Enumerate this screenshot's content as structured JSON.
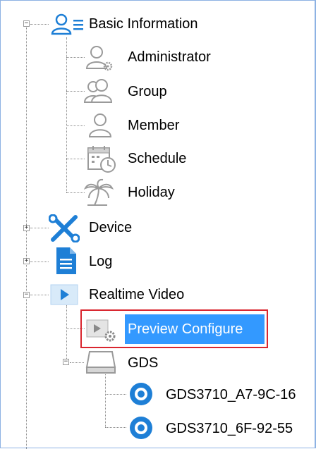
{
  "tree": {
    "basic_information": {
      "label": "Basic Information",
      "icon": "users-list-icon",
      "children": [
        {
          "label": "Administrator",
          "icon": "admin-user-icon"
        },
        {
          "label": "Group",
          "icon": "group-icon"
        },
        {
          "label": "Member",
          "icon": "member-icon"
        },
        {
          "label": "Schedule",
          "icon": "schedule-calendar-icon"
        },
        {
          "label": "Holiday",
          "icon": "palm-tree-icon"
        }
      ]
    },
    "device": {
      "label": "Device",
      "icon": "tools-icon"
    },
    "log": {
      "label": "Log",
      "icon": "document-icon"
    },
    "realtime_video": {
      "label": "Realtime Video",
      "icon": "play-icon",
      "preview_configure": {
        "label": "Preview Configure",
        "icon": "play-gear-icon"
      },
      "gds": {
        "label": "GDS",
        "icon": "device-box-icon",
        "children": [
          {
            "label": "GDS3710_A7-9C-16",
            "icon": "camera-icon"
          },
          {
            "label": "GDS3710_6F-92-55",
            "icon": "camera-icon"
          }
        ]
      }
    }
  },
  "colors": {
    "selection": "#3399ff",
    "highlight_box": "#d9262f",
    "icon_blue": "#1e7fd6"
  }
}
